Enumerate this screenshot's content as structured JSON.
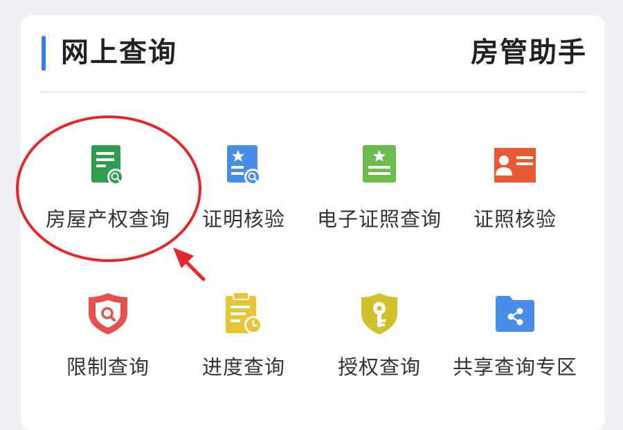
{
  "header": {
    "title": "网上查询",
    "helper": "房管助手"
  },
  "colors": {
    "accent": "#3a7de9",
    "annotation": "#e8262a"
  },
  "items": [
    {
      "label": "房屋产权查询",
      "icon": "document-search-icon",
      "color": "#2e9d4e"
    },
    {
      "label": "证明核验",
      "icon": "certificate-verify-icon",
      "color": "#4a8de8"
    },
    {
      "label": "电子证照查询",
      "icon": "e-license-icon",
      "color": "#6cbb4d"
    },
    {
      "label": "证照核验",
      "icon": "id-card-icon",
      "color": "#e85a35"
    },
    {
      "label": "限制查询",
      "icon": "shield-search-icon",
      "color": "#e85050"
    },
    {
      "label": "进度查询",
      "icon": "clipboard-clock-icon",
      "color": "#e9c436"
    },
    {
      "label": "授权查询",
      "icon": "shield-key-icon",
      "color": "#d1c12d"
    },
    {
      "label": "共享查询专区",
      "icon": "shared-folder-icon",
      "color": "#4a8de8"
    }
  ]
}
